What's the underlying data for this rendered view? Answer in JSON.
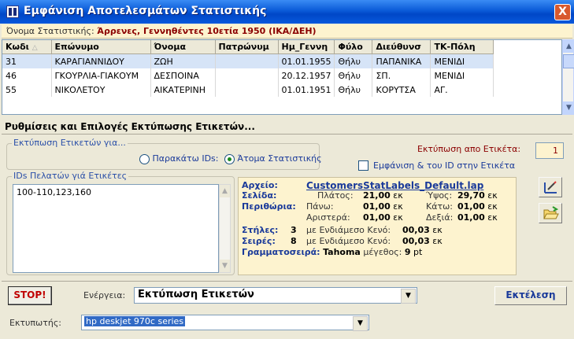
{
  "window": {
    "title": "Εμφάνιση Αποτελεσμάτων Στατιστικής",
    "close": "X"
  },
  "stat": {
    "label": "Όνομα Στατιστικής:",
    "value": "Άρρενες, Γεννηθέντες 10ετία 1950 (ΙΚΑ/ΔΕΗ)"
  },
  "grid": {
    "columns": [
      "Κωδι",
      "Επώνυμο",
      "Όνομα",
      "Πατρώνυμ",
      "Ημ_Γεννη",
      "Φύλο",
      "Διεύθυνσ",
      "ΤΚ-Πόλη"
    ],
    "rows": [
      [
        "31",
        "ΚΑΡΑΓΙΑΝΝΙΔΟΥ",
        "ΖΩΗ",
        "",
        "01.01.1955",
        "Θήλυ",
        "ΠΑΠΑΝΙΚΑ",
        "ΜΕΝΙΔΙ"
      ],
      [
        "46",
        "ΓΚΟΥΡΛΙΑ-ΓΙΑΚΟΥΜ",
        "ΔΕΣΠΟΙΝΑ",
        "",
        "20.12.1957",
        "Θήλυ",
        "ΣΠ.",
        "ΜΕΝΙΔΙ"
      ],
      [
        "55",
        "ΝΙΚΟΛΕΤΟΥ",
        "ΑΙΚΑΤΕΡΙΝΗ",
        "",
        "01.01.1951",
        "Θήλυ",
        "ΚΟΡΥΤΣΑ",
        "ΑΓ."
      ]
    ]
  },
  "section": {
    "title": "Ρυθμίσεις και Επιλογές Εκτύπωσης Ετικετών..."
  },
  "print_for": {
    "title": "Εκτύπωση Ετικετών για...",
    "option_ids": "Παρακάτω IDs:",
    "option_people": "Άτομα Στατιστικής",
    "selected": "Άτομα Στατιστικής"
  },
  "start_label": {
    "label": "Εκτύπωση απο Ετικέτα:",
    "value": "1"
  },
  "show_id": {
    "label": "Εμφάνιση & του ID στην Ετικέτα",
    "checked": false
  },
  "ids": {
    "title": "IDs Πελατών γιά Ετικέτες",
    "value": "100-110,123,160"
  },
  "info": {
    "file_label": "Αρχείο:",
    "file": "CustomersStatLabels_Default.lap",
    "page_label": "Σελίδα:",
    "width_label": "Πλάτος:",
    "width": "21,00",
    "height_label": "Ύψος:",
    "height": "29,70",
    "margins_label": "Περιθώρια:",
    "top_label": "Πάνω:",
    "top": "01,00",
    "bottom_label": "Κάτω:",
    "bottom": "01,00",
    "left_label": "Αριστερά:",
    "left": "01,00",
    "right_label": "Δεξιά:",
    "right": "01,00",
    "unit": "εκ",
    "cols_label": "Στήλες:",
    "cols": "3",
    "gap_label": "με Ενδιάμεσο Κενό:",
    "cols_gap": "00,03",
    "rows_label": "Σειρές:",
    "rows": "8",
    "rows_gap": "00,03",
    "font_label": "Γραμματοσειρά:",
    "font": "Tahoma",
    "size_label": "μέγεθος:",
    "size": "9",
    "size_unit": "pt"
  },
  "actions": {
    "stop": "STOP!",
    "action_label": "Ενέργεια:",
    "action_value": "Εκτύπωση Ετικετών",
    "execute": "Εκτέλεση",
    "printer_label": "Εκτυπωτής:",
    "printer_value": "hp deskjet 970c series"
  },
  "colors": {
    "title_bar": "#0a5ad8",
    "info_bg": "#fdf3cf",
    "accent_red": "#8b0000",
    "label_blue": "#1a3a9a"
  },
  "icons": [
    "app-icon",
    "close-icon",
    "edit-layout-icon",
    "open-folder-icon",
    "dropdown-arrow-icon"
  ]
}
